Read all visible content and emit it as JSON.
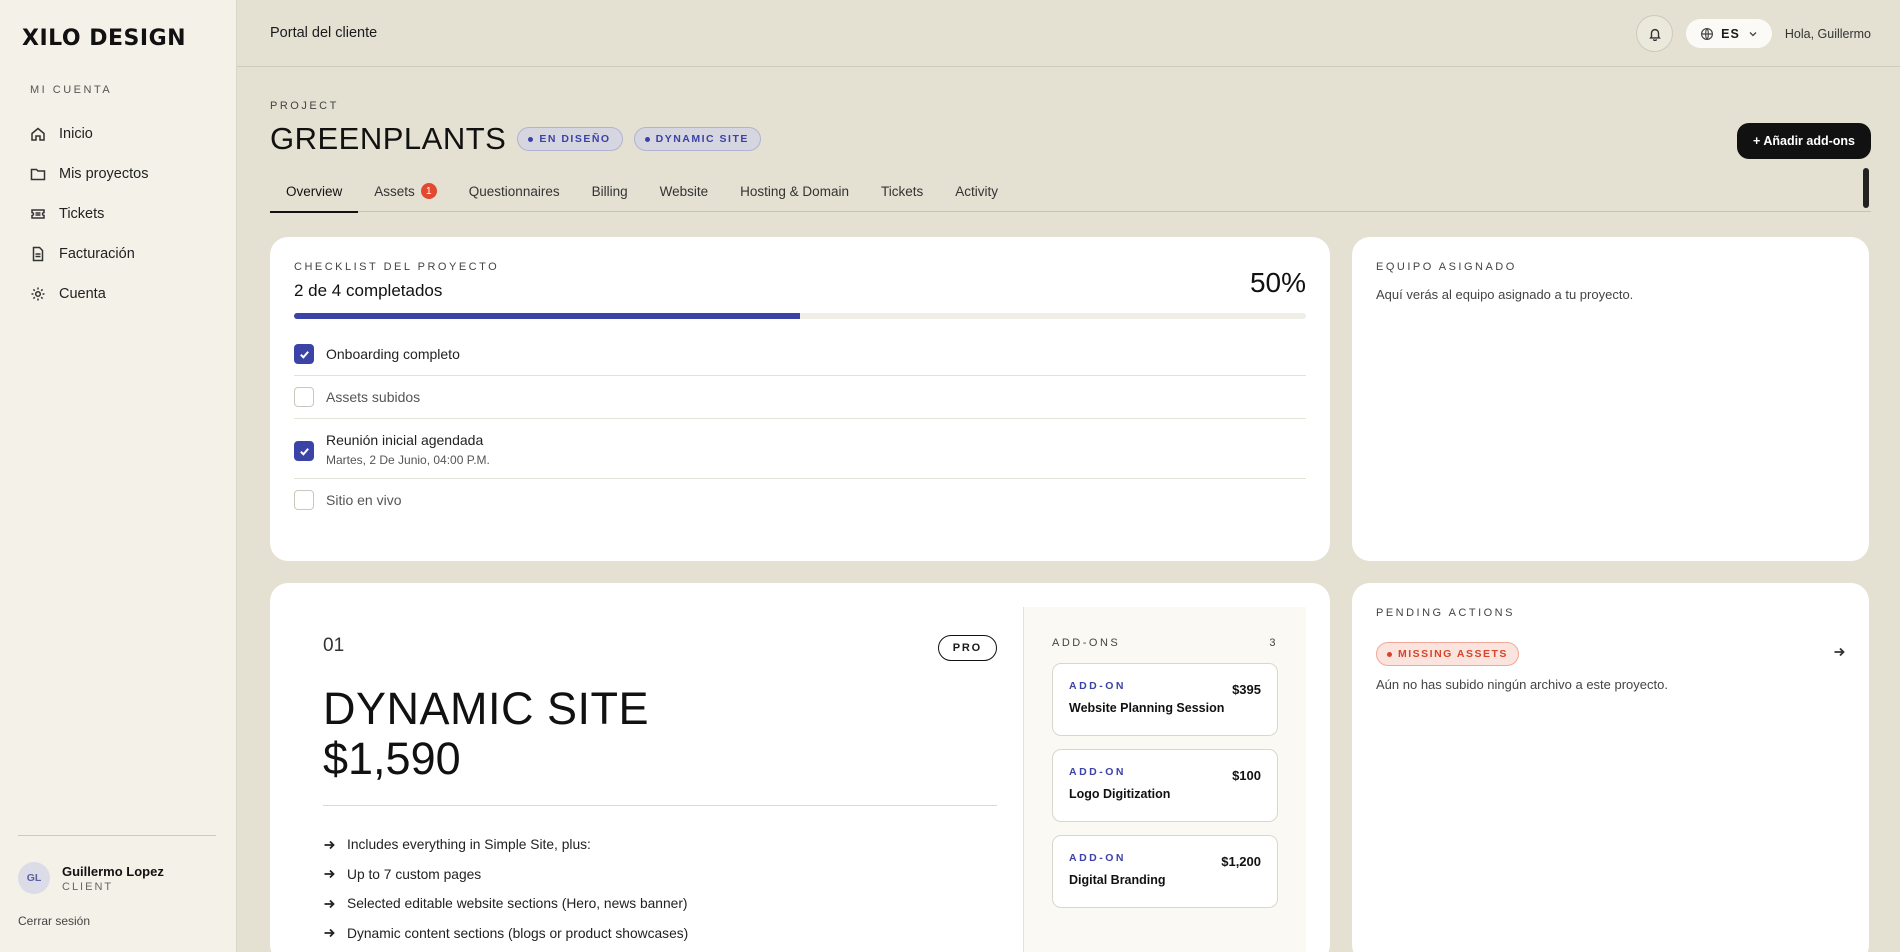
{
  "sidebar": {
    "logo": "XILO DESIGN",
    "heading": "MI CUENTA",
    "items": [
      {
        "label": "Inicio",
        "icon": "home-icon"
      },
      {
        "label": "Mis proyectos",
        "icon": "folder-icon"
      },
      {
        "label": "Tickets",
        "icon": "ticket-icon"
      },
      {
        "label": "Facturación",
        "icon": "invoice-icon"
      },
      {
        "label": "Cuenta",
        "icon": "gear-icon"
      }
    ],
    "user": {
      "initials": "GL",
      "name": "Guillermo Lopez",
      "role": "CLIENT"
    },
    "logout": "Cerrar sesión"
  },
  "topbar": {
    "title": "Portal del cliente",
    "language": "ES",
    "greeting": "Hola, Guillermo"
  },
  "project": {
    "label": "PROJECT",
    "name": "GREENPLANTS",
    "chips": [
      "EN DISEÑO",
      "DYNAMIC SITE"
    ],
    "add_button": "+ Añadir add-ons"
  },
  "tabs": [
    {
      "label": "Overview",
      "active": true
    },
    {
      "label": "Assets",
      "badge": "1"
    },
    {
      "label": "Questionnaires"
    },
    {
      "label": "Billing"
    },
    {
      "label": "Website"
    },
    {
      "label": "Hosting & Domain"
    },
    {
      "label": "Tickets"
    },
    {
      "label": "Activity"
    }
  ],
  "checklist": {
    "label": "CHECKLIST DEL PROYECTO",
    "summary": "2 de 4 completados",
    "percent_text": "50%",
    "progress": 0.5,
    "items": [
      {
        "title": "Onboarding completo",
        "checked": true
      },
      {
        "title": "Assets subidos",
        "checked": false
      },
      {
        "title": "Reunión inicial agendada",
        "subtitle": "Martes, 2 De Junio, 04:00 P.M.",
        "checked": true
      },
      {
        "title": "Sitio en vivo",
        "checked": false
      }
    ]
  },
  "team": {
    "label": "EQUIPO ASIGNADO",
    "description": "Aquí verás al equipo asignado a tu proyecto."
  },
  "plan": {
    "number": "01",
    "badge": "PRO",
    "name": "DYNAMIC SITE",
    "price": "$1,590",
    "features": [
      "Includes everything in Simple Site, plus:",
      "Up to 7 custom pages",
      "Selected editable website sections (Hero, news banner)",
      "Dynamic content sections (blogs or product showcases)"
    ],
    "addons_label": "ADD-ONS",
    "addons_count": "3",
    "addons": [
      {
        "tag": "ADD-ON",
        "name": "Website Planning Session",
        "price": "$395"
      },
      {
        "tag": "ADD-ON",
        "name": "Logo Digitization",
        "price": "$100"
      },
      {
        "tag": "ADD-ON",
        "name": "Digital Branding",
        "price": "$1,200"
      }
    ]
  },
  "pending": {
    "label": "PENDING ACTIONS",
    "chip": "MISSING ASSETS",
    "description": "Aún no has subido ningún archivo a este proyecto."
  },
  "colors": {
    "accent": "#3c43a6",
    "alert": "#d7442a",
    "background": "#e4e0d2",
    "sidebar": "#f3f1e8"
  }
}
